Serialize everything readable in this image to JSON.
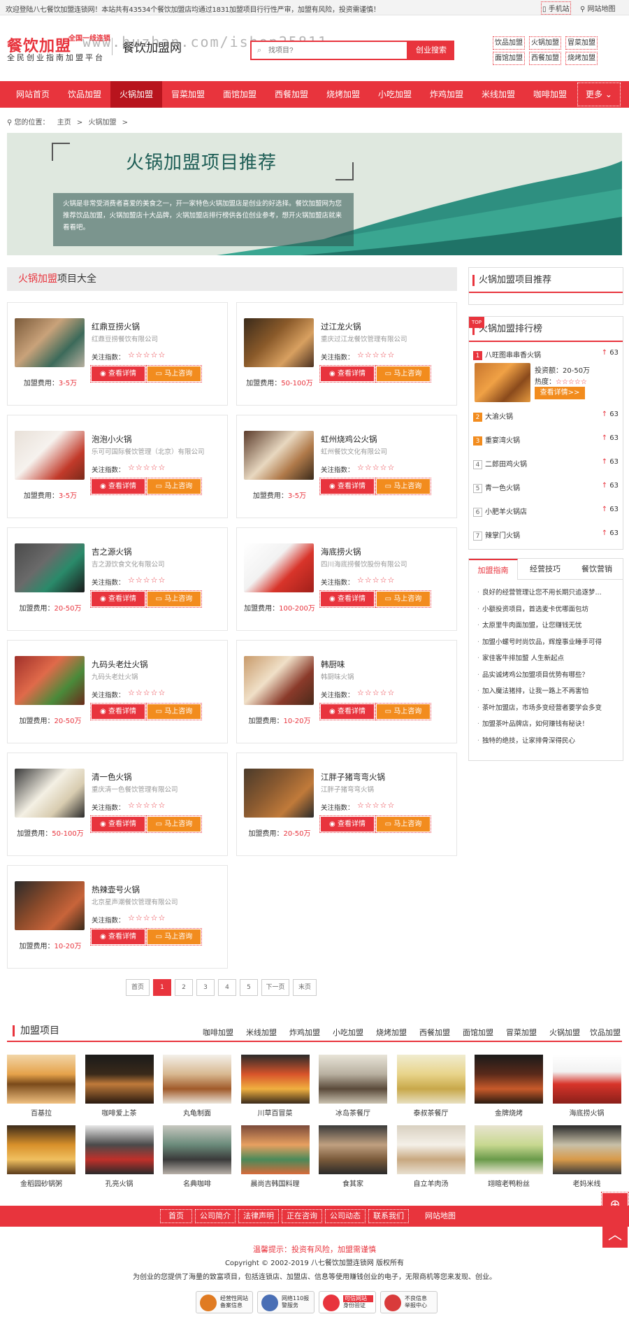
{
  "topbar": {
    "welcome": "欢迎登陆八七餐饮加盟连锁网！本站共有43534个餐饮加盟店均通过1831加盟项目行行性严审，加盟有风险，投资需谨慎！",
    "mobile": "手机站",
    "sitemap": "网站地图"
  },
  "header": {
    "logo_main": "餐饮加盟",
    "logo_badge": "全国一线连锁",
    "logo_sub": "全民创业指南加盟平台",
    "site_name": "餐饮加盟网",
    "watermark": "www.huzhan.com/ishop25811",
    "search_placeholder": "找项目?",
    "search_button": "创业搜索",
    "hot_links": [
      "饮品加盟",
      "火锅加盟",
      "冒菜加盟",
      "面馆加盟",
      "西餐加盟",
      "烧烤加盟"
    ]
  },
  "nav": {
    "items": [
      "网站首页",
      "饮品加盟",
      "火锅加盟",
      "冒菜加盟",
      "面馆加盟",
      "西餐加盟",
      "烧烤加盟",
      "小吃加盟",
      "炸鸡加盟",
      "米线加盟",
      "咖啡加盟"
    ],
    "more": "更多"
  },
  "breadcrumb": {
    "label": "您的位置：",
    "home": "主页",
    "current": "火锅加盟"
  },
  "banner": {
    "title": "火锅加盟项目推荐",
    "desc": "火锅是非常受消费者喜爱的美食之一，开一家特色火锅加盟店是创业的好选择。餐饮加盟网为您推荐饮品加盟，火锅加盟店十大品牌，火锅加盟店排行榜供各位创业参考，想开火锅加盟店就来看看吧。"
  },
  "list": {
    "title_red": "火锅加盟",
    "title_rest": "项目大全",
    "fee_label": "加盟费用：",
    "attention_label": "关注指数：",
    "btn_detail": "查看详情",
    "btn_consult": "马上咨询",
    "stars": "☆☆☆☆☆",
    "items": [
      {
        "name": "红鼎豆捞火锅",
        "company": "红鼎豆捞餐饮有限公司",
        "fee": "3-5万"
      },
      {
        "name": "过江龙火锅",
        "company": "重庆过江龙餐饮管理有限公司",
        "fee": "50-100万"
      },
      {
        "name": "泡泡小火锅",
        "company": "乐可可国际餐饮管理（北京）有限公司",
        "fee": "3-5万"
      },
      {
        "name": "虹州烧鸡公火锅",
        "company": "虹州餐饮文化有限公司",
        "fee": "3-5万"
      },
      {
        "name": "吉之源火锅",
        "company": "吉之源饮食文化有限公司",
        "fee": "20-50万"
      },
      {
        "name": "海底捞火锅",
        "company": "四川海底捞餐饮股份有限公司",
        "fee": "100-200万"
      },
      {
        "name": "九码头老灶火锅",
        "company": "九码头老灶火锅",
        "fee": "20-50万"
      },
      {
        "name": "韩厨味",
        "company": "韩厨味火锅",
        "fee": "10-20万"
      },
      {
        "name": "清一色火锅",
        "company": "重庆清一色餐饮管理有限公司",
        "fee": "50-100万"
      },
      {
        "name": "江胖子猪弯弯火锅",
        "company": "江胖子猪弯弯火锅",
        "fee": "20-50万"
      },
      {
        "name": "热辣壶号火锅",
        "company": "北京星声潮餐饮管理有限公司",
        "fee": "10-20万"
      }
    ]
  },
  "pager": [
    "首页",
    "1",
    "2",
    "3",
    "4",
    "5",
    "下一页",
    "末页"
  ],
  "sidebar": {
    "recommend_title": "火锅加盟项目推荐",
    "rank_title": "火锅加盟排行榜",
    "rank_top": {
      "name": "八旺图串串香火锅",
      "invest_label": "投资额：",
      "invest": "20-50万",
      "heat_label": "热度：",
      "btn": "查看详情>>",
      "score": "63"
    },
    "rank_items": [
      {
        "num": "2",
        "name": "大渝火锅",
        "score": "63"
      },
      {
        "num": "3",
        "name": "重宴湾火锅",
        "score": "63"
      },
      {
        "num": "4",
        "name": "二郎田鸡火锅",
        "score": "63"
      },
      {
        "num": "5",
        "name": "青一色火锅",
        "score": "63"
      },
      {
        "num": "6",
        "name": "小肥羊火锅店",
        "score": "63"
      },
      {
        "num": "7",
        "name": "辣掌门火锅",
        "score": "63"
      }
    ],
    "tabs": [
      "加盟指南",
      "经营技巧",
      "餐饮营销"
    ],
    "news": [
      "良好的经营管理让您不用长期只追逐梦...",
      "小额投资项目，首选麦卡优哪面包坊",
      "太原里牛肉面加盟，让您赚钱无忧",
      "加盟小螺号时尚饮品，辉煌事业睡手可得",
      "家佳客牛排加盟 人生新起点",
      "品实诚烤鸡公加盟项目优势有哪些？",
      "加入魔法猪排，让我一路上不再害怕",
      "茶叶加盟店，市场多变经营者要学会多变",
      "加盟茶叶品牌店，如何赚钱有秘诀！",
      "独特的绝技，让家排骨深得民心"
    ]
  },
  "join": {
    "title": "加盟项目",
    "categories": [
      "咖啡加盟",
      "米线加盟",
      "炸鸡加盟",
      "小吃加盟",
      "烧烤加盟",
      "西餐加盟",
      "面馆加盟",
      "冒菜加盟",
      "火锅加盟",
      "饮品加盟"
    ],
    "tiles": [
      "百基拉",
      "咖啡爱上茶",
      "丸龟制面",
      "川草百冒菜",
      "冰岛茶餐厅",
      "泰叔茶餐厅",
      "金牌烧烤",
      "海底捞火锅",
      "金稻园砂锅粥",
      "孔亮火锅",
      "名典咖啡",
      "晨尚吉韩国料理",
      "食其家",
      "自立羊肉汤",
      "翊暄老鸭粉丝",
      "老妈米线"
    ]
  },
  "footer": {
    "links": [
      "首页",
      "公司简介",
      "法律声明",
      "正在咨询",
      "公司动态",
      "联系我们",
      "网站地图"
    ],
    "warning": "温馨提示：投资有风险，加盟需谨慎",
    "copyright": "Copyright © 2002-2019 八七餐饮加盟连锁网 版权所有",
    "intro": "为创业的您提供了海量的致富项目，包括连锁店、加盟店、信息等使用赚钱创业的电子，无限商机等您来发现、创业。",
    "badges": [
      {
        "l1": "经营性网站",
        "l2": "备案信息"
      },
      {
        "l1": "网络110报",
        "l2": "警服务"
      },
      {
        "l1": "可信网站",
        "l2": "身份验证"
      },
      {
        "l1": "不良信息",
        "l2": "举报中心"
      }
    ]
  }
}
